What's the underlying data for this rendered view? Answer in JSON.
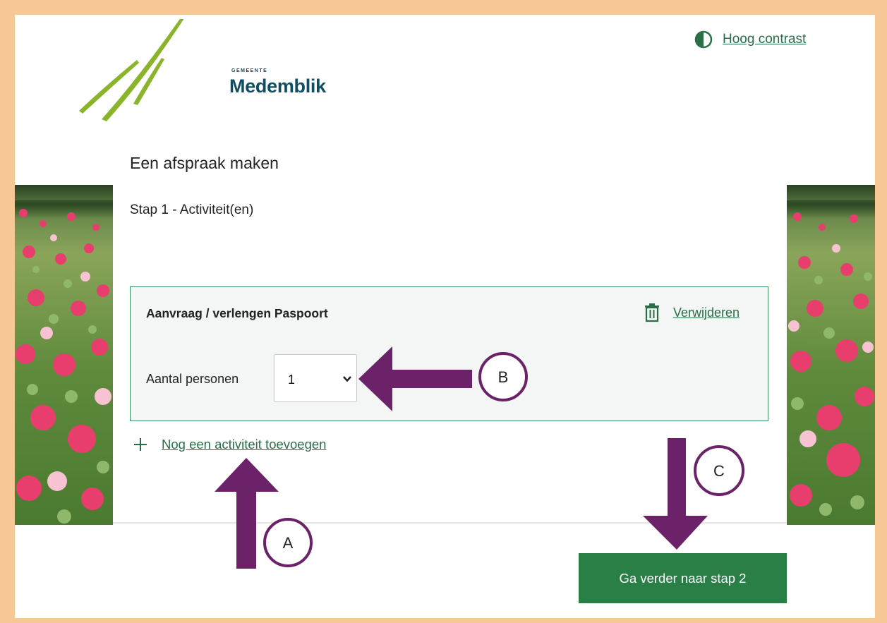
{
  "header": {
    "logo_small": "GEMEENTE",
    "logo_name": "Medemblik",
    "contrast_link": "Hoog contrast"
  },
  "main": {
    "page_title": "Een afspraak maken",
    "step_title": "Stap 1 - Activiteit(en)"
  },
  "activity": {
    "name": "Aanvraag / verlengen Paspoort",
    "remove_label": "Verwijderen",
    "persons_label": "Aantal personen",
    "persons_value": "1"
  },
  "add_activity_label": "Nog een activiteit toevoegen",
  "next_button_label": "Ga verder naar stap 2",
  "annotations": {
    "a": "A",
    "b": "B",
    "c": "C"
  },
  "colors": {
    "accent_green": "#2a7f47",
    "link_green": "#2a6e46",
    "annotation_purple": "#6b2268",
    "frame_orange": "#f5c895"
  }
}
